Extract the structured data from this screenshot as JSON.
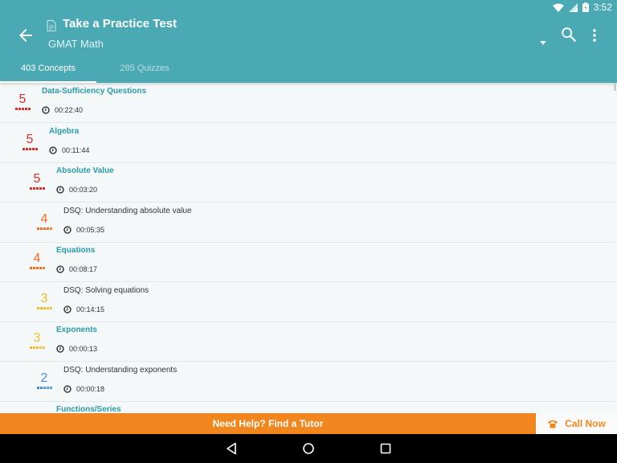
{
  "status_bar": {
    "time": "3:52",
    "icons": [
      "wifi-icon",
      "signal-icon",
      "battery-icon"
    ]
  },
  "app_bar": {
    "title": "Take a Practice Test",
    "subtitle": "GMAT Math",
    "icons": [
      "back-arrow-icon",
      "document-icon",
      "dropdown-caret-icon",
      "search-icon",
      "more-vert-icon"
    ]
  },
  "tabs": [
    {
      "label": "403 Concepts",
      "active": true
    },
    {
      "label": "285 Quizzes",
      "active": false
    }
  ],
  "rating_colors": {
    "5": "#d32f2f",
    "4": "#ef6c1f",
    "3": "#f2b92b",
    "2": "#3f8fd6",
    "1": "#8bc34a"
  },
  "rows": [
    {
      "rating": "5",
      "level": 5,
      "title": "Data-Sufficiency Questions",
      "type": "concept",
      "time": "00:22:40"
    },
    {
      "rating": "5",
      "level": 5,
      "title": "Algebra",
      "type": "concept",
      "time": "00:11:44"
    },
    {
      "rating": "5",
      "level": 5,
      "title": "Absolute Value",
      "type": "concept",
      "time": "00:03:20"
    },
    {
      "rating": "4",
      "level": 4,
      "title": "DSQ: Understanding absolute value",
      "type": "quiz",
      "time": "00:05:35"
    },
    {
      "rating": "4",
      "level": 4,
      "title": "Equations",
      "type": "concept",
      "time": "00:08:17"
    },
    {
      "rating": "3",
      "level": 3,
      "title": "DSQ: Solving equations",
      "type": "quiz",
      "time": "00:14:15"
    },
    {
      "rating": "3",
      "level": 3,
      "title": "Exponents",
      "type": "concept",
      "time": "00:00:13"
    },
    {
      "rating": "2",
      "level": 2,
      "title": "DSQ: Understanding exponents",
      "type": "quiz",
      "time": "00:00:18"
    },
    {
      "rating": "",
      "level": 0,
      "title": "Functions/Series",
      "type": "concept",
      "time": ""
    }
  ],
  "bottom": {
    "help_label": "Need Help? Find a Tutor",
    "call_label": "Call Now",
    "call_icon": "phone-icon"
  },
  "nav_bar": {
    "icons": [
      "nav-back-icon",
      "nav-home-icon",
      "nav-recents-icon"
    ]
  }
}
